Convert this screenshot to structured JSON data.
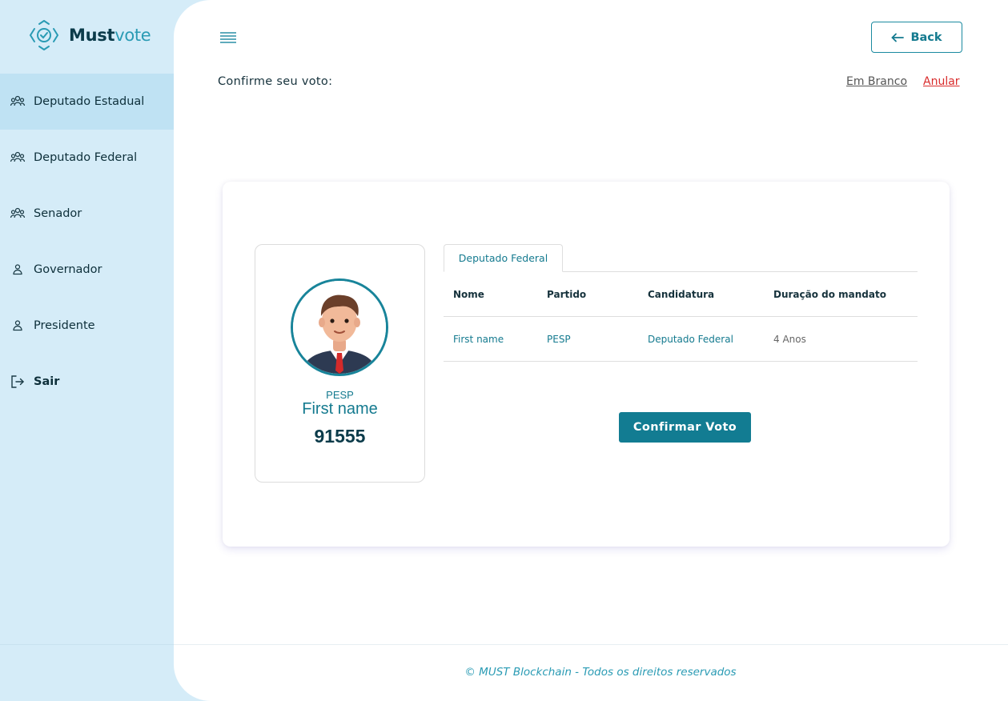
{
  "brand": {
    "name_main": "Must",
    "name_accent": "vote"
  },
  "sidebar": {
    "items": [
      {
        "label": "Deputado Estadual",
        "icon": "group-icon",
        "active": true
      },
      {
        "label": "Deputado Federal",
        "icon": "group-icon",
        "active": false
      },
      {
        "label": "Senador",
        "icon": "group-icon",
        "active": false
      },
      {
        "label": "Governador",
        "icon": "person-icon",
        "active": false
      },
      {
        "label": "Presidente",
        "icon": "person-icon",
        "active": false
      }
    ],
    "logout_label": "Sair"
  },
  "header": {
    "back_label": "Back",
    "confirm_title": "Confirme seu voto:",
    "blank_label": "Em Branco",
    "annul_label": "Anular"
  },
  "candidate": {
    "party": "PESP",
    "name": "First name",
    "number": "91555"
  },
  "tab": {
    "label": "Deputado Federal"
  },
  "table": {
    "headers": [
      "Nome",
      "Partido",
      "Candidatura",
      "Duração do mandato"
    ],
    "rows": [
      [
        "First name",
        "PESP",
        "Deputado Federal",
        "4 Anos"
      ]
    ]
  },
  "confirm_button": "Confirmar Voto",
  "footer": "© MUST Blockchain - Todos os direitos reservados",
  "colors": {
    "primary": "#127c92",
    "sidebar_bg": "#d5ecf8",
    "sidebar_active": "#bfe2f3",
    "danger": "#d92b2b"
  }
}
